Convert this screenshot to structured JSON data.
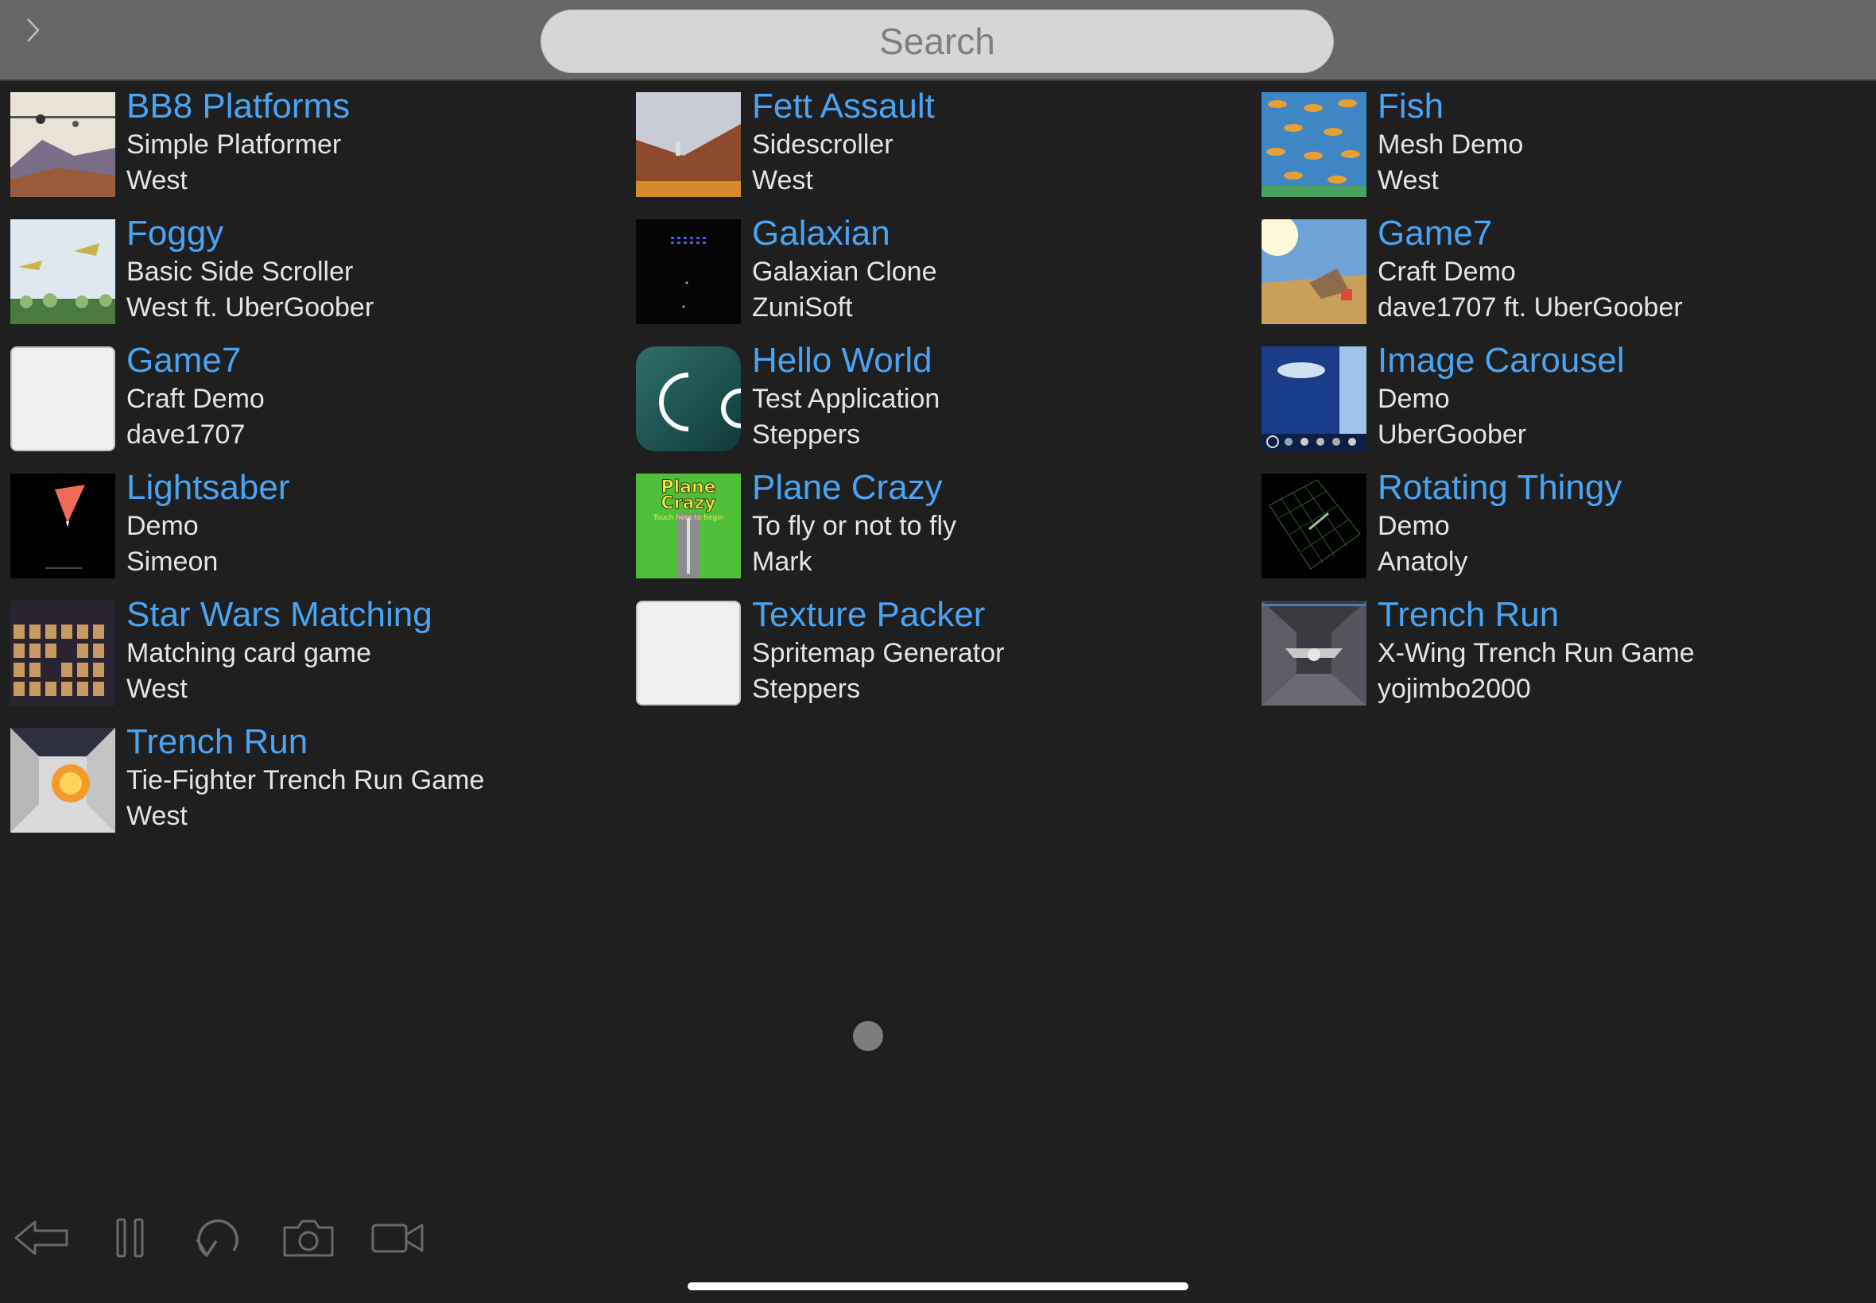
{
  "header": {
    "search_placeholder": "Search"
  },
  "projects": [
    {
      "title": "BB8 Platforms",
      "subtitle": "Simple Platformer",
      "author": "West",
      "icon": "bb8-platforms-thumbnail"
    },
    {
      "title": "Fett Assault",
      "subtitle": "Sidescroller",
      "author": "West",
      "icon": "fett-assault-thumbnail"
    },
    {
      "title": "Fish",
      "subtitle": "Mesh Demo",
      "author": "West",
      "icon": "fish-thumbnail"
    },
    {
      "title": "Foggy",
      "subtitle": "Basic Side Scroller",
      "author": "West ft. UberGoober",
      "icon": "foggy-thumbnail"
    },
    {
      "title": "Galaxian",
      "subtitle": "Galaxian Clone",
      "author": "ZuniSoft",
      "icon": "galaxian-thumbnail"
    },
    {
      "title": "Game7",
      "subtitle": "Craft Demo",
      "author": "dave1707 ft. UberGoober",
      "icon": "game7-thumbnail"
    },
    {
      "title": "Game7",
      "subtitle": "Craft Demo",
      "author": "dave1707",
      "icon": "blank-thumbnail"
    },
    {
      "title": "Hello World",
      "subtitle": "Test Application",
      "author": "Steppers",
      "icon": "codea-thumbnail"
    },
    {
      "title": "Image Carousel",
      "subtitle": "Demo",
      "author": "UberGoober",
      "icon": "image-carousel-thumbnail"
    },
    {
      "title": "Lightsaber",
      "subtitle": "Demo",
      "author": "Simeon",
      "icon": "lightsaber-thumbnail"
    },
    {
      "title": "Plane Crazy",
      "subtitle": "To fly or not to fly",
      "author": "Mark",
      "icon": "plane-crazy-thumbnail",
      "thumb_text": [
        "Plane",
        "Crazy",
        "Touch here to begin"
      ]
    },
    {
      "title": "Rotating Thingy",
      "subtitle": "Demo",
      "author": "Anatoly",
      "icon": "rotating-thingy-thumbnail"
    },
    {
      "title": "Star Wars Matching",
      "subtitle": "Matching card game",
      "author": "West",
      "icon": "star-wars-matching-thumbnail"
    },
    {
      "title": "Texture Packer",
      "subtitle": "Spritemap Generator",
      "author": "Steppers",
      "icon": "blank-thumbnail"
    },
    {
      "title": "Trench Run",
      "subtitle": "X-Wing Trench Run Game",
      "author": "yojimbo2000",
      "icon": "x-wing-trench-thumbnail"
    },
    {
      "title": "Trench Run",
      "subtitle": "Tie-Fighter Trench Run Game",
      "author": "West",
      "icon": "tie-fighter-trench-thumbnail"
    }
  ],
  "pager": {
    "current_page": 1,
    "total_pages": 1
  },
  "toolbar": {
    "icons": [
      "back-arrow-icon",
      "pause-icon",
      "restart-icon",
      "camera-icon",
      "video-camera-icon"
    ]
  },
  "colors": {
    "background": "#1f1f1f",
    "header": "#676767",
    "title": "#4aa4f2",
    "text": "#e4e4e4"
  }
}
